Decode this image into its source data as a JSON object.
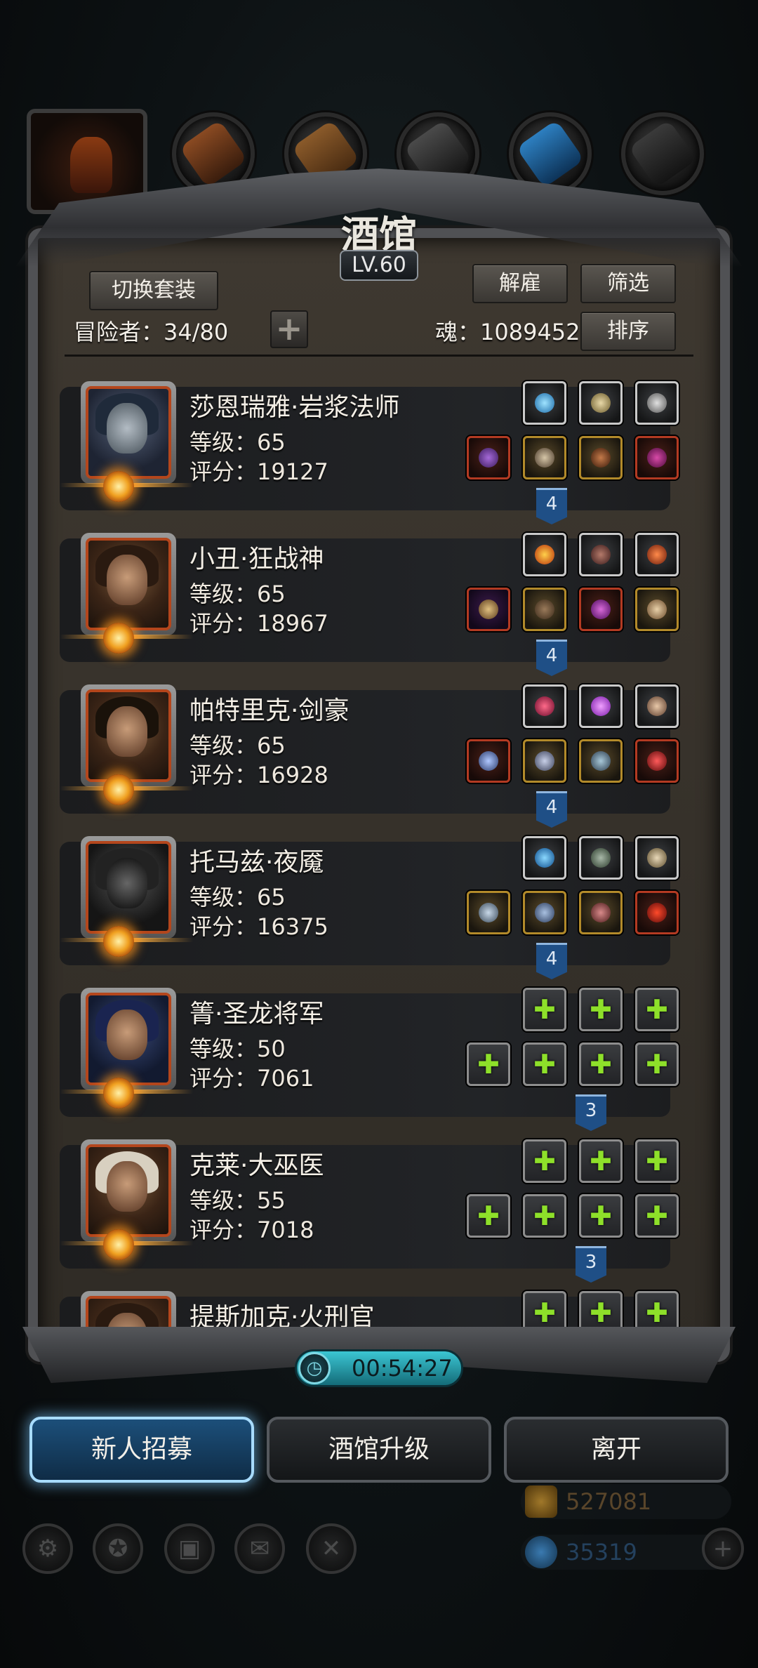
{
  "header": {
    "title": "酒馆",
    "level": "LV.60"
  },
  "toolbar": {
    "switch_outfit": "切换套装",
    "dismiss": "解雇",
    "filter": "筛选",
    "sort": "排序",
    "adventurers_label": "冒险者：34/80",
    "soul_label": "魂：1089452"
  },
  "heroes": [
    {
      "name": "莎恩瑞雅·岩浆法师",
      "level": "等级：65",
      "score": "评分：19127",
      "badge": "4"
    },
    {
      "name": "小丑·狂战神",
      "level": "等级：65",
      "score": "评分：18967",
      "badge": "4"
    },
    {
      "name": "帕特里克·剑豪",
      "level": "等级：65",
      "score": "评分：16928",
      "badge": "4"
    },
    {
      "name": "托马兹·夜魇",
      "level": "等级：65",
      "score": "评分：16375",
      "badge": "4"
    },
    {
      "name": "箐·圣龙将军",
      "level": "等级：50",
      "score": "评分：7061",
      "badge": "3"
    },
    {
      "name": "克莱·大巫医",
      "level": "等级：55",
      "score": "评分：7018",
      "badge": "3"
    },
    {
      "name": "提斯加克·火刑官",
      "level": "",
      "score": "",
      "badge": ""
    }
  ],
  "timer": "00:54:27",
  "buttons": {
    "recruit": "新人招募",
    "upgrade": "酒馆升级",
    "leave": "离开"
  },
  "currency": {
    "gold": "527081",
    "gems": "35319"
  },
  "colors": {
    "accent": "#a8dcff",
    "equip_green": "#8ee02a",
    "ribbon": "#1f4f86"
  }
}
